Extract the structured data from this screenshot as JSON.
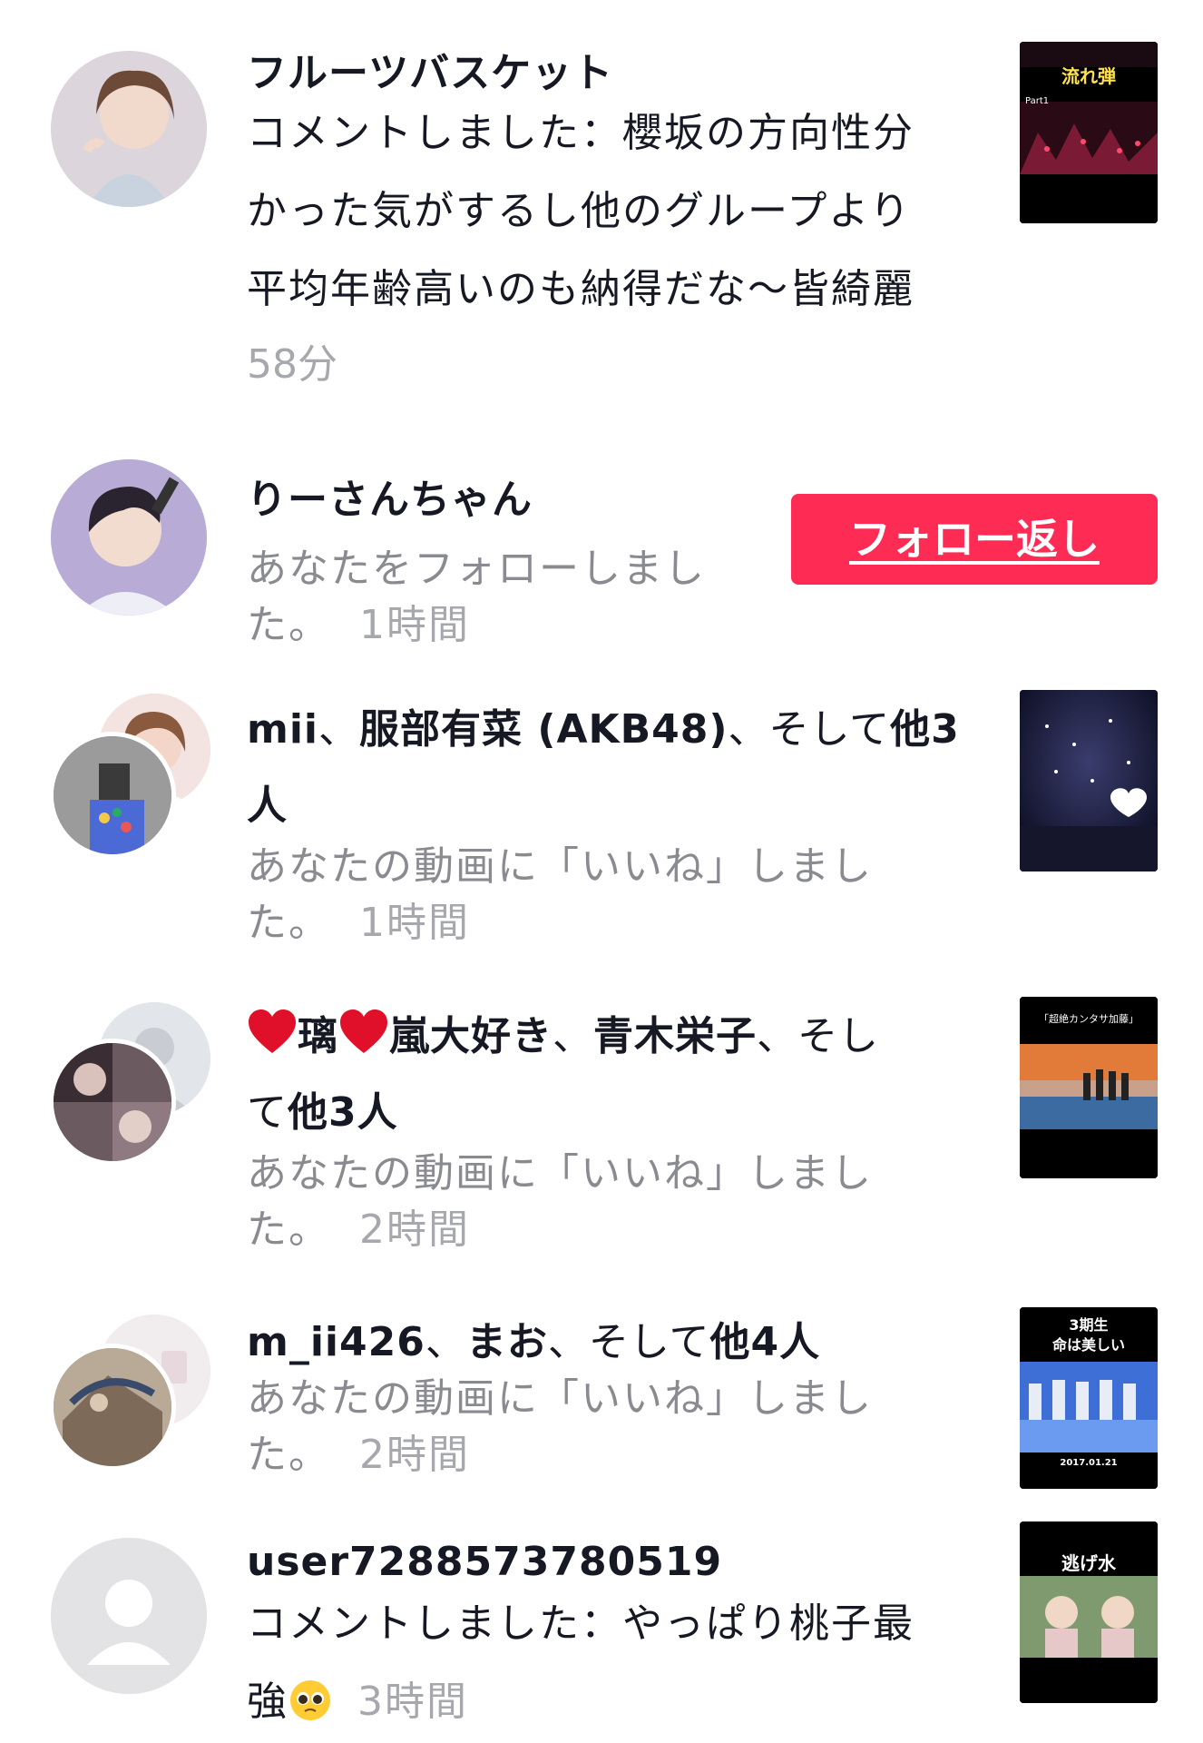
{
  "notifications": [
    {
      "name": "フルーツバスケット",
      "lines": [
        "コメントしました：櫻坂の方向性分",
        "かった気がするし他のグループより",
        "平均年齢高いのも納得だな〜皆綺麗"
      ],
      "time": "58分",
      "thumb_text": [
        "流れ弾",
        "Part1"
      ]
    },
    {
      "name": "りーさんちゃん",
      "line1": "あなたをフォローしまし",
      "line2": "た。",
      "time": "1時間",
      "button_label": "フォロー返し"
    },
    {
      "name_a": "mii",
      "sep1": "、",
      "name_b": "服部有菜 (AKB48)",
      "sep2": "、そして",
      "others": "他3",
      "others_line2": "人",
      "line1": "あなたの動画に「いいね」しまし",
      "line2": "た。",
      "time": "1時間"
    },
    {
      "name_a": "璃",
      "name_b": "嵐大好き",
      "sep1": "、",
      "name_c": "青木栄子",
      "sep2": "、そし",
      "line_b_prefix": "て",
      "others": "他3人",
      "line1": "あなたの動画に「いいね」しまし",
      "line2": "た。",
      "time": "2時間",
      "thumb_text": [
        "「超絶カンタサ加藤」"
      ]
    },
    {
      "name_a": "m_ii426",
      "sep1": "、",
      "name_b": "まお",
      "sep2": "、そして",
      "others": "他4人",
      "line1": "あなたの動画に「いいね」しまし",
      "line2": "た。",
      "time": "2時間",
      "thumb_text": [
        "3期生",
        "命は美しい",
        "2017.01.21"
      ]
    },
    {
      "name": "user7288573780519",
      "line1": "コメントしました：やっぱり桃子最",
      "line2": "強",
      "time": "3時間",
      "thumb_text": [
        "逃げ水"
      ]
    }
  ],
  "colors": {
    "accent": "#fe2c55",
    "heart": "#e0102a",
    "grey_text": "#8a8b91"
  }
}
